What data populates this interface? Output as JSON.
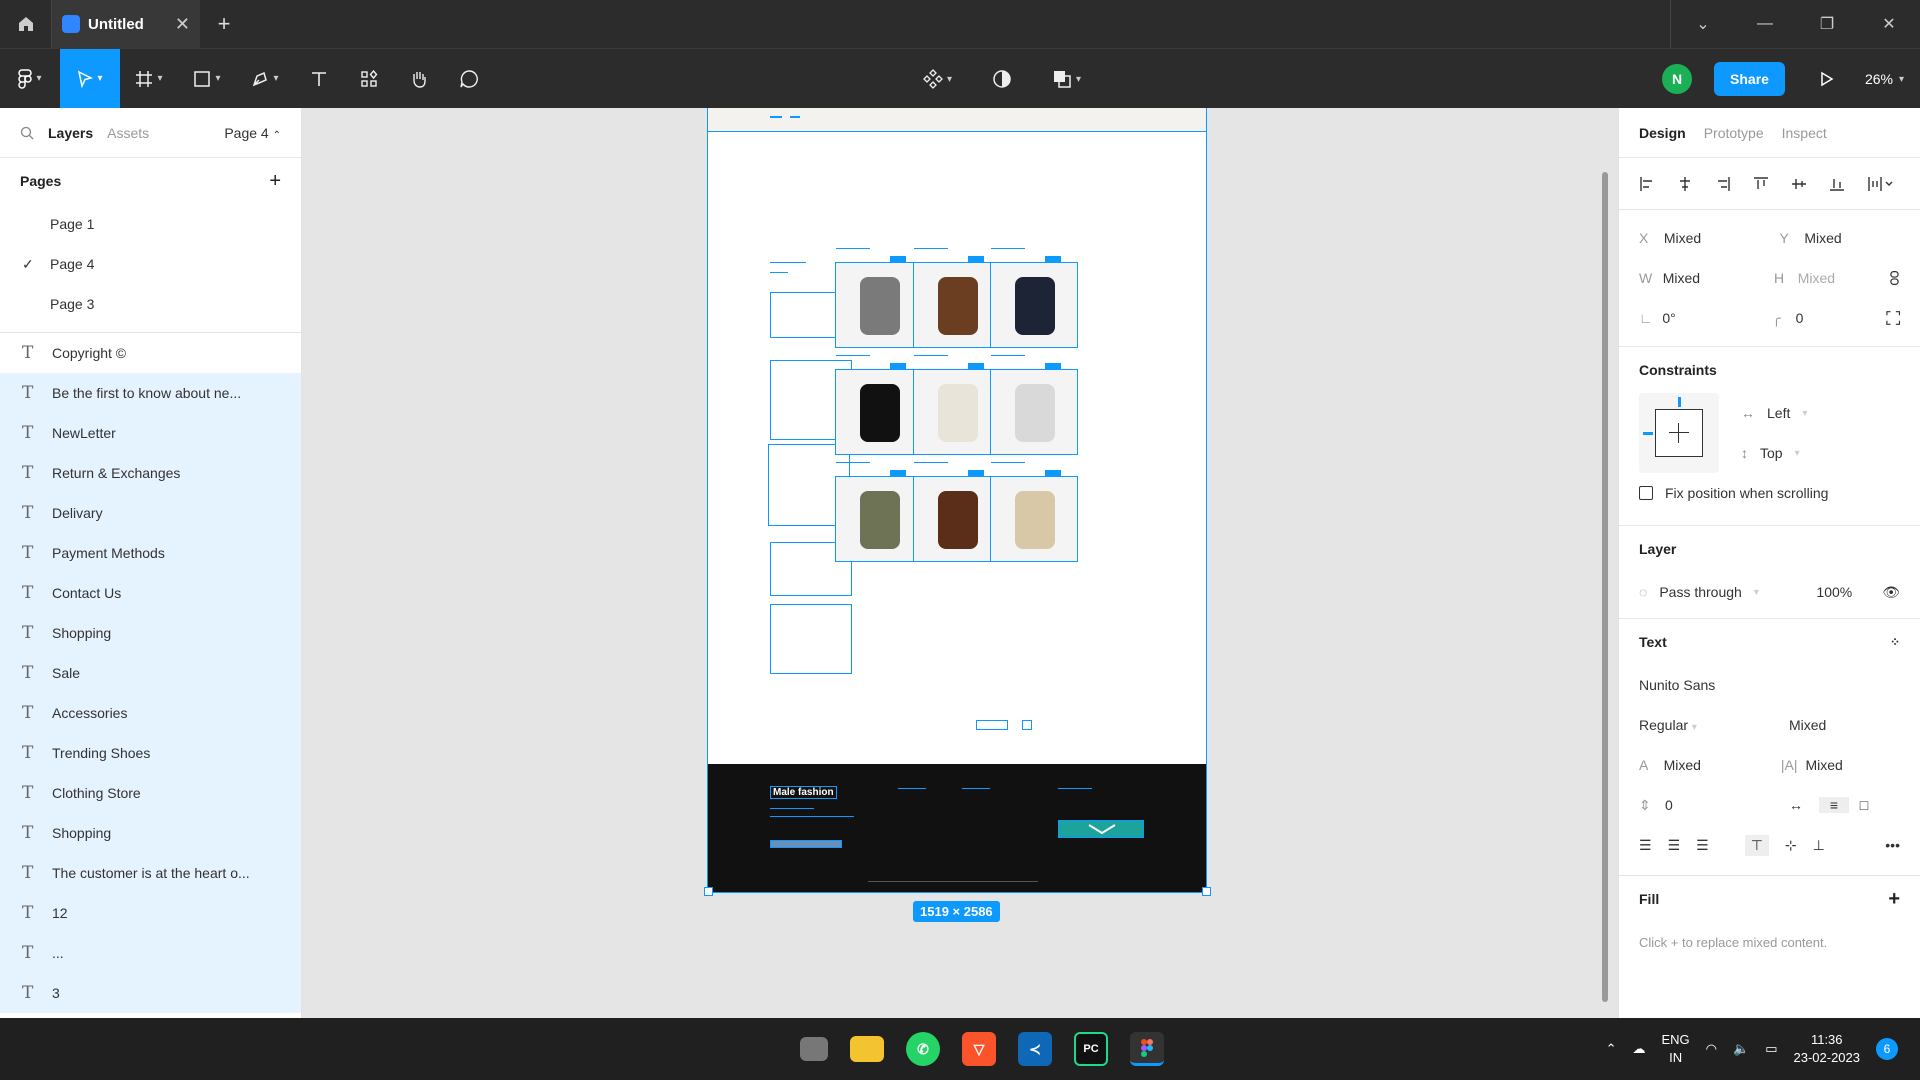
{
  "titlebar": {
    "file_name": "Untitled",
    "close_glyph": "✕",
    "new_tab_glyph": "+"
  },
  "toolbar": {
    "zoom": "26%",
    "share_label": "Share",
    "avatar_initial": "N"
  },
  "left_panel": {
    "tabs": {
      "layers": "Layers",
      "assets": "Assets"
    },
    "current_page": "Page 4",
    "pages_header": "Pages",
    "pages": [
      {
        "label": "Page 1",
        "selected": false
      },
      {
        "label": "Page 4",
        "selected": true
      },
      {
        "label": "Page 3",
        "selected": false
      }
    ],
    "layers": [
      {
        "label": "Copyright ©",
        "selected": false
      },
      {
        "label": "Be the first to know about ne...",
        "selected": true
      },
      {
        "label": "NewLetter",
        "selected": true
      },
      {
        "label": "Return & Exchanges",
        "selected": true
      },
      {
        "label": "Delivary",
        "selected": true
      },
      {
        "label": "Payment Methods",
        "selected": true
      },
      {
        "label": "Contact Us",
        "selected": true
      },
      {
        "label": "Shopping",
        "selected": true
      },
      {
        "label": "Sale",
        "selected": true
      },
      {
        "label": "Accessories",
        "selected": true
      },
      {
        "label": "Trending Shoes",
        "selected": true
      },
      {
        "label": "Clothing Store",
        "selected": true
      },
      {
        "label": "Shopping",
        "selected": true
      },
      {
        "label": "The customer is at the heart o...",
        "selected": true
      },
      {
        "label": "12",
        "selected": true
      },
      {
        "label": "...",
        "selected": true
      },
      {
        "label": "3",
        "selected": true
      }
    ]
  },
  "canvas": {
    "frame_size": "1519 × 2586",
    "footer_brand": "Male fashion"
  },
  "right_panel": {
    "tabs": {
      "design": "Design",
      "prototype": "Prototype",
      "inspect": "Inspect"
    },
    "x_label": "X",
    "x_value": "Mixed",
    "y_label": "Y",
    "y_value": "Mixed",
    "w_label": "W",
    "w_value": "Mixed",
    "h_label": "H",
    "h_value": "Mixed",
    "rotation": "0°",
    "radius": "0",
    "constraints_title": "Constraints",
    "constraint_h": "Left",
    "constraint_v": "Top",
    "fix_position_label": "Fix position when scrolling",
    "layer_title": "Layer",
    "blend_mode": "Pass through",
    "opacity": "100%",
    "text_title": "Text",
    "font_family": "Nunito Sans",
    "font_weight": "Regular",
    "font_size": "Mixed",
    "line_height": "Mixed",
    "letter_spacing": "Mixed",
    "paragraph_spacing": "0",
    "fill_title": "Fill",
    "fill_hint": "Click + to replace mixed content."
  },
  "taskbar": {
    "lang_line1": "ENG",
    "lang_line2": "IN",
    "time": "11:36",
    "date": "23-02-2023",
    "notification_count": "6"
  },
  "colors": {
    "accent": "#0d99ff",
    "titlebar_bg": "#2c2c2c",
    "canvas_bg": "#e5e5e5",
    "selection_bg": "#e5f2ff",
    "avatar": "#1bb055"
  }
}
